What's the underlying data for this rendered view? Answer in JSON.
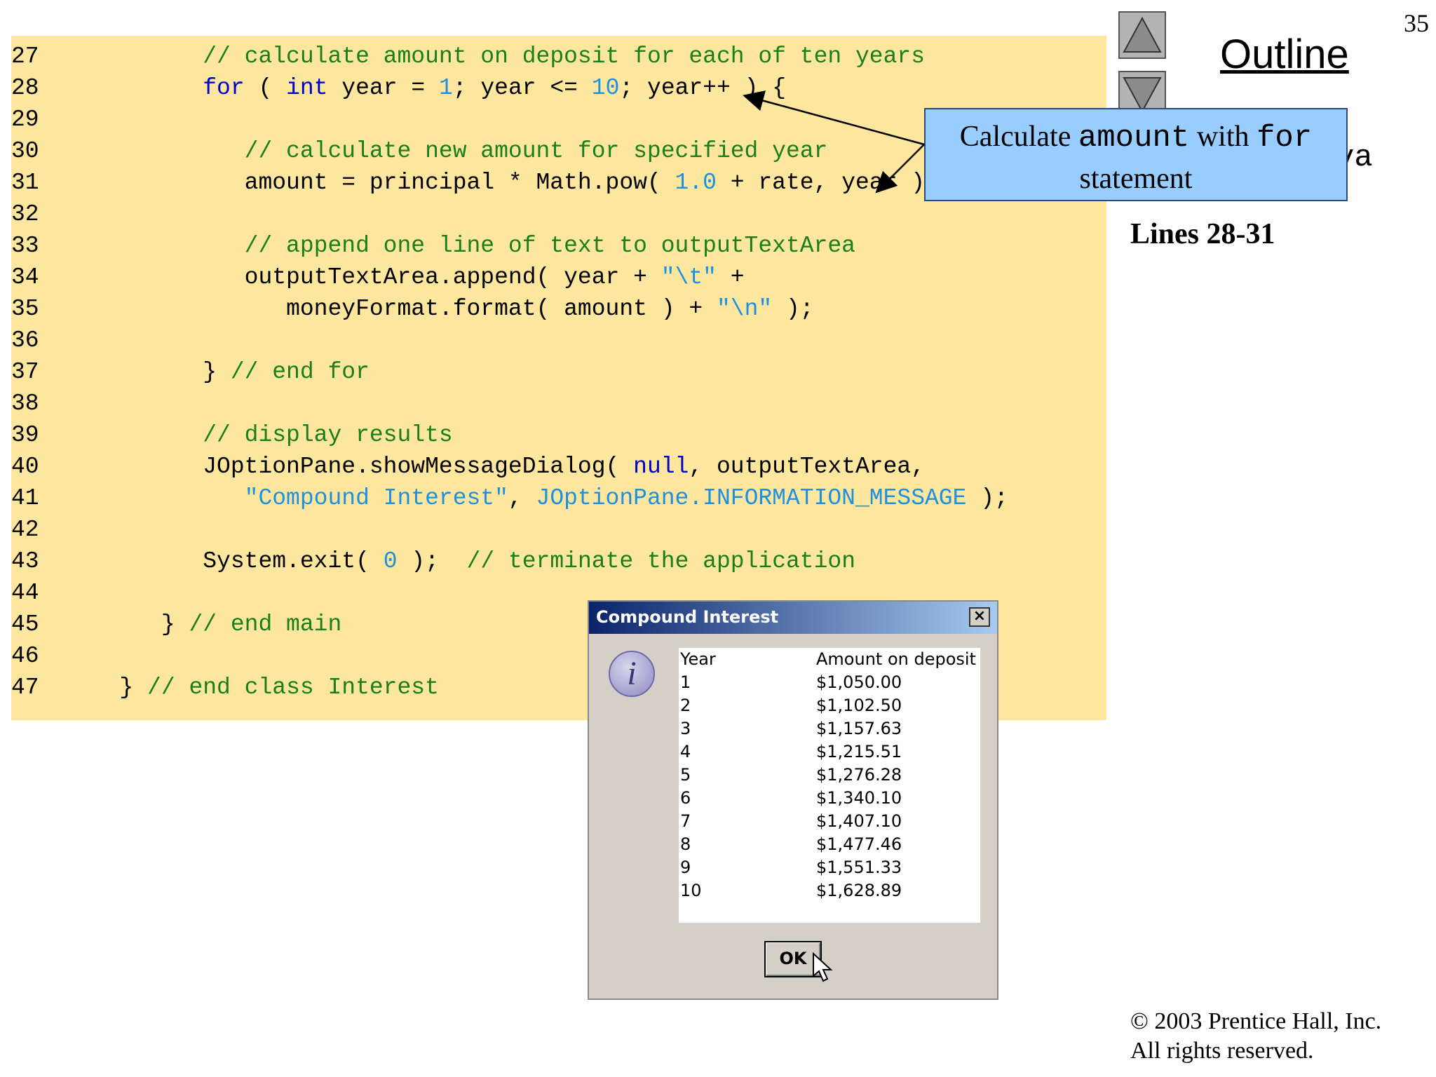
{
  "page_number": "35",
  "nav": {
    "up_label": "",
    "down_label": ""
  },
  "outline_title": "Outline",
  "filename_fragment": "va",
  "callout": {
    "text1": "Calculate ",
    "code1": "amount",
    "text2": " with ",
    "code2": "for",
    "text3": "statement"
  },
  "lines_label": "Lines 28-31",
  "copyright": {
    "line1": "© 2003 Prentice Hall, Inc.",
    "line2": "All rights reserved."
  },
  "code": {
    "l27": {
      "n": "27",
      "c1": "// calculate amount on deposit for each of ten years"
    },
    "l28": {
      "n": "28",
      "kw1": "for",
      "p1": " ( ",
      "kw2": "int",
      "p2": " year = ",
      "n1": "1",
      "p3": "; year <= ",
      "n2": "10",
      "p4": "; year++ ) {"
    },
    "l29": {
      "n": "29"
    },
    "l30": {
      "n": "30",
      "c1": "// calculate new amount for specified year"
    },
    "l31": {
      "n": "31",
      "p1": "amount = principal * Math.pow( ",
      "n1": "1.0",
      "p2": " + rate, year );"
    },
    "l32": {
      "n": "32"
    },
    "l33": {
      "n": "33",
      "c1": "// append one line of text to outputTextArea"
    },
    "l34": {
      "n": "34",
      "p1": "outputTextArea.append( year + ",
      "s1": "\"\\t\"",
      "p2": " +"
    },
    "l35": {
      "n": "35",
      "p1": "moneyFormat.format( amount ) + ",
      "s1": "\"\\n\"",
      "p2": " );"
    },
    "l36": {
      "n": "36"
    },
    "l37": {
      "n": "37",
      "p1": "} ",
      "c1": "// end for"
    },
    "l38": {
      "n": "38"
    },
    "l39": {
      "n": "39",
      "c1": "// display results"
    },
    "l40": {
      "n": "40",
      "p1": "JOptionPane.showMessageDialog( ",
      "kw1": "null",
      "p2": ", outputTextArea,"
    },
    "l41": {
      "n": "41",
      "s1": "\"Compound Interest\"",
      "p1": ", ",
      "c2": "JOptionPane.INFORMATION_MESSAGE",
      "p2": " );"
    },
    "l42": {
      "n": "42"
    },
    "l43": {
      "n": "43",
      "p1": "System.exit( ",
      "n1": "0",
      "p2": " );  ",
      "c1": "// terminate the application"
    },
    "l44": {
      "n": "44"
    },
    "l45": {
      "n": "45",
      "p1": "} ",
      "c1": "// end main"
    },
    "l46": {
      "n": "46"
    },
    "l47": {
      "n": "47",
      "p1": "} ",
      "c1": "// end class Interest"
    }
  },
  "dialog": {
    "title": "Compound Interest",
    "close_label": "×",
    "icon_glyph": "i",
    "ok_label": "OK",
    "header": {
      "year": "Year",
      "amount": "Amount on deposit"
    },
    "rows": [
      {
        "year": "1",
        "amount": "$1,050.00"
      },
      {
        "year": "2",
        "amount": "$1,102.50"
      },
      {
        "year": "3",
        "amount": "$1,157.63"
      },
      {
        "year": "4",
        "amount": "$1,215.51"
      },
      {
        "year": "5",
        "amount": "$1,276.28"
      },
      {
        "year": "6",
        "amount": "$1,340.10"
      },
      {
        "year": "7",
        "amount": "$1,407.10"
      },
      {
        "year": "8",
        "amount": "$1,477.46"
      },
      {
        "year": "9",
        "amount": "$1,551.33"
      },
      {
        "year": "10",
        "amount": "$1,628.89"
      }
    ]
  }
}
